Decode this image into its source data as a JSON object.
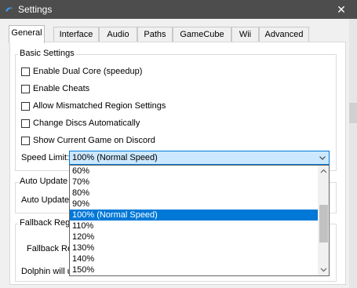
{
  "window": {
    "title": "Settings",
    "close_glyph": "✕"
  },
  "tabs": [
    {
      "label": "General",
      "active": true
    },
    {
      "label": "Interface",
      "active": false
    },
    {
      "label": "Audio",
      "active": false
    },
    {
      "label": "Paths",
      "active": false
    },
    {
      "label": "GameCube",
      "active": false
    },
    {
      "label": "Wii",
      "active": false
    },
    {
      "label": "Advanced",
      "active": false
    }
  ],
  "basic_settings": {
    "title": "Basic Settings",
    "checkboxes": [
      {
        "label": "Enable Dual Core (speedup)",
        "checked": false
      },
      {
        "label": "Enable Cheats",
        "checked": false
      },
      {
        "label": "Allow Mismatched Region Settings",
        "checked": false
      },
      {
        "label": "Change Discs Automatically",
        "checked": false
      },
      {
        "label": "Show Current Game on Discord",
        "checked": false
      }
    ],
    "speed_limit_label": "Speed Limit:",
    "speed_limit_value": "100% (Normal Speed)"
  },
  "auto_update": {
    "title": "Auto Update S",
    "label": "Auto Update:"
  },
  "fallback_region": {
    "title": "Fallback Regi",
    "label": "Fallback Re",
    "note": "Dolphin will u"
  },
  "speed_dropdown": {
    "options": [
      "60%",
      "70%",
      "80%",
      "90%",
      "100% (Normal Speed)",
      "110%",
      "120%",
      "130%",
      "140%",
      "150%"
    ],
    "selected_index": 4
  },
  "colors": {
    "titlebar": "#4d4d4d",
    "selection": "#0078d7",
    "combo_highlight": "#cce8ff"
  },
  "icons": {
    "app": "dolphin-logo-icon",
    "close": "close-icon",
    "dropdown": "chevron-down-icon",
    "scroll_up": "scroll-up-arrow-icon",
    "scroll_down": "scroll-down-arrow-icon"
  }
}
